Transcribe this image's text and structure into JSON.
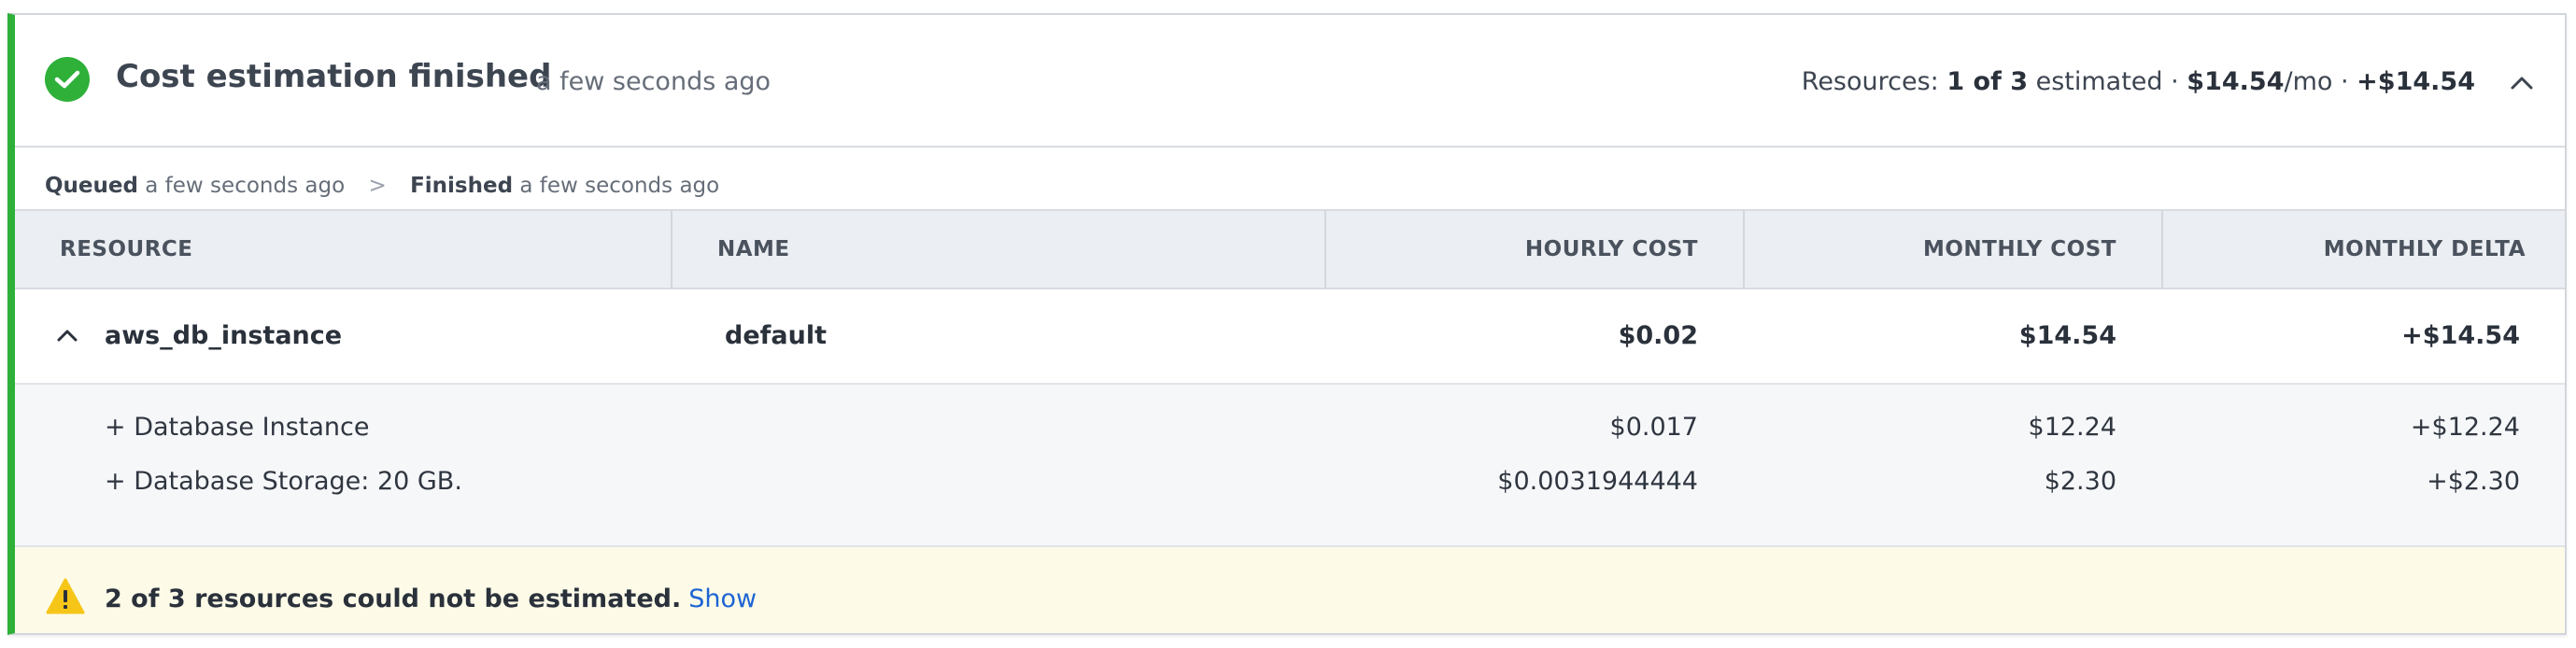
{
  "header": {
    "title": "Cost estimation finished",
    "time": "a few seconds ago",
    "summary": {
      "prefix": "Resources: ",
      "count": "1 of 3",
      "estimated": " estimated · ",
      "monthly": "$14.54",
      "per_mo": "/mo · ",
      "delta": "+$14.54"
    }
  },
  "timeline": {
    "queued_label": "Queued",
    "queued_time": "a few seconds ago",
    "separator": ">",
    "finished_label": "Finished",
    "finished_time": "a few seconds ago"
  },
  "table": {
    "columns": [
      "RESOURCE",
      "NAME",
      "HOURLY COST",
      "MONTHLY COST",
      "MONTHLY DELTA"
    ],
    "rows": [
      {
        "resource": "aws_db_instance",
        "name": "default",
        "hourly": "$0.02",
        "monthly": "$14.54",
        "delta": "+$14.54",
        "details": [
          {
            "label": "+ Database Instance",
            "hourly": "$0.017",
            "monthly": "$12.24",
            "delta": "+$12.24"
          },
          {
            "label": "+ Database Storage: 20 GB.",
            "hourly": "$0.0031944444",
            "monthly": "$2.30",
            "delta": "+$2.30"
          }
        ]
      }
    ]
  },
  "warning": {
    "text": "2 of 3 resources could not be estimated.",
    "link": "Show"
  },
  "colors": {
    "success": "#2eb039",
    "warning": "#f5c518",
    "link": "#1d64d4"
  },
  "icons": {
    "status": "check-circle-icon",
    "collapse": "chevron-up-icon",
    "row_toggle": "chevron-up-icon",
    "warning": "warning-triangle-icon"
  }
}
